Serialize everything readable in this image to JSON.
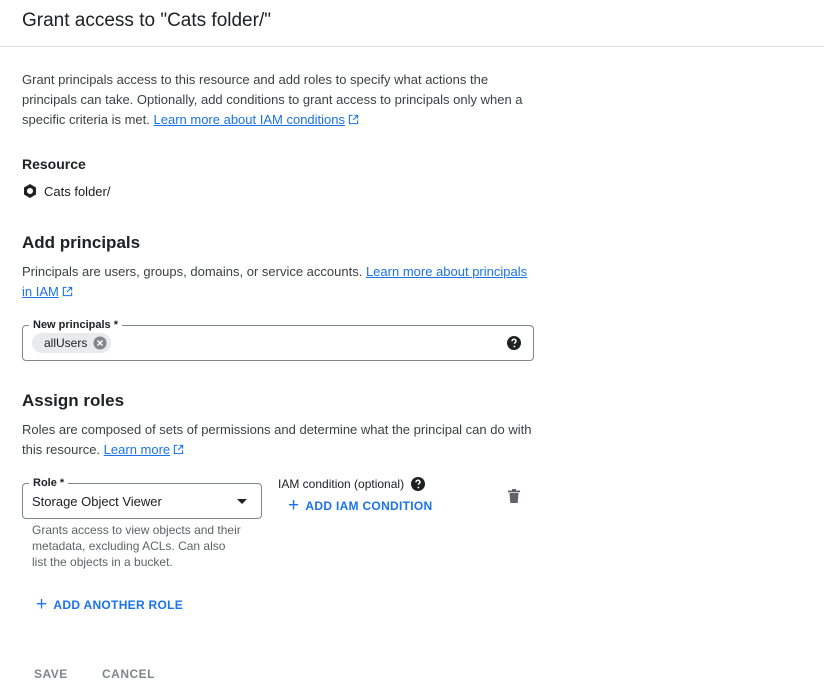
{
  "dialog": {
    "title": "Grant access to \"Cats folder/\"",
    "intro_text": "Grant principals access to this resource and add roles to specify what actions the principals can take. Optionally, add conditions to grant access to principals only when a specific criteria is met.",
    "intro_link": "Learn more about IAM conditions"
  },
  "resource": {
    "heading": "Resource",
    "name": "Cats folder/",
    "icon": "bucket-icon"
  },
  "principals": {
    "heading": "Add principals",
    "description": "Principals are users, groups, domains, or service accounts.",
    "link": "Learn more about principals in IAM",
    "field_label": "New principals *",
    "chips": [
      "allUsers"
    ]
  },
  "roles": {
    "heading": "Assign roles",
    "description": "Roles are composed of sets of permissions and determine what the principal can do with this resource.",
    "link": "Learn more",
    "role_label": "Role *",
    "role_value": "Storage Object Viewer",
    "role_help": "Grants access to view objects and their metadata, excluding ACLs. Can also list the objects in a bucket.",
    "iam_condition_label": "IAM condition (optional)",
    "add_iam_condition": "ADD IAM CONDITION",
    "add_another_role": "ADD ANOTHER ROLE"
  },
  "footer": {
    "save": "SAVE",
    "cancel": "CANCEL"
  },
  "colors": {
    "link": "#1a73e8",
    "disabled_text": "#80868b",
    "border": "#80868b",
    "chip_bg": "#e8eaed"
  }
}
